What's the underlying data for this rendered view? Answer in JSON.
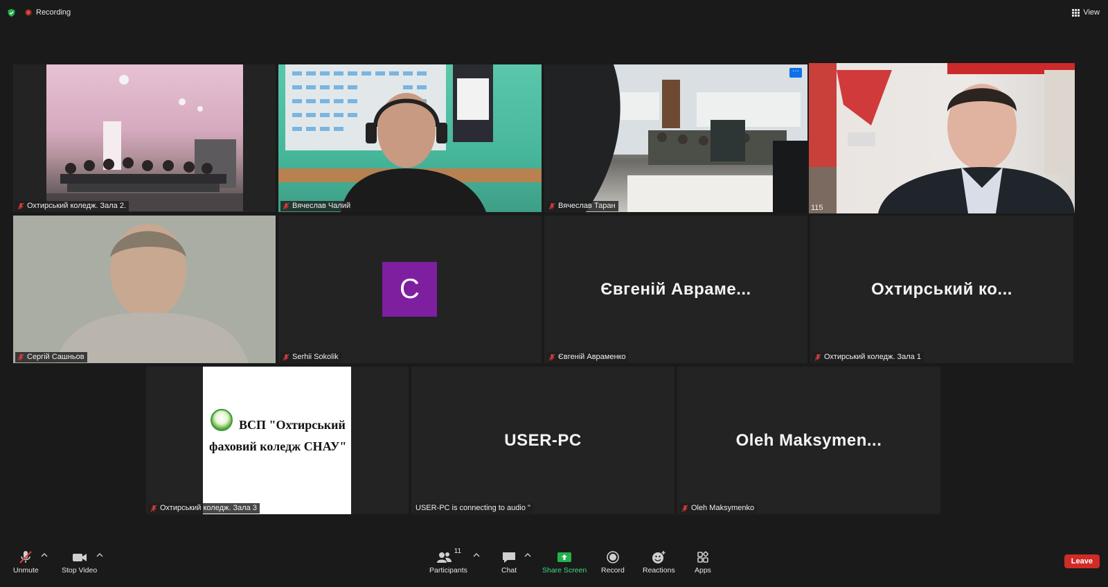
{
  "topbar": {
    "recording_label": "Recording",
    "view_label": "View"
  },
  "tiles": [
    {
      "name": "Охтирський коледж. Зала 2."
    },
    {
      "name": "Вячеслав Чалий"
    },
    {
      "name": "Вячеслав Таран"
    },
    {
      "number": "115"
    },
    {
      "name": "Сергій Сашньов"
    },
    {
      "name": "Serhii Sokolik",
      "avatar_letter": "C"
    },
    {
      "name": "Євгеній Авраменко",
      "display_name": "Євгеній Авраме..."
    },
    {
      "name": "Охтирський коледж. Зала 1",
      "display_name": "Охтирський ко..."
    },
    {
      "name": "Охтирський коледж. Зала 3",
      "logo_line1": "ВСП \"Охтирський",
      "logo_line2": "фаховий коледж СНАУ\""
    },
    {
      "name": "USER-PC is connecting to audio \"",
      "display_name": "USER-PC"
    },
    {
      "name": "Oleh Maksymenko",
      "display_name": "Oleh  Maksymen..."
    }
  ],
  "toolbar": {
    "unmute_label": "Unmute",
    "stop_video_label": "Stop Video",
    "participants_label": "Participants",
    "participants_count": "11",
    "chat_label": "Chat",
    "share_screen_label": "Share Screen",
    "record_label": "Record",
    "reactions_label": "Reactions",
    "apps_label": "Apps",
    "leave_label": "Leave"
  },
  "colors": {
    "background": "#1a1a1a",
    "tile": "#232323",
    "active_speaker_border": "#d4e84a",
    "leave": "#cf2b27",
    "share_screen": "#3ddc84",
    "avatar": "#7e1fa0",
    "more_button": "#0e71eb"
  }
}
